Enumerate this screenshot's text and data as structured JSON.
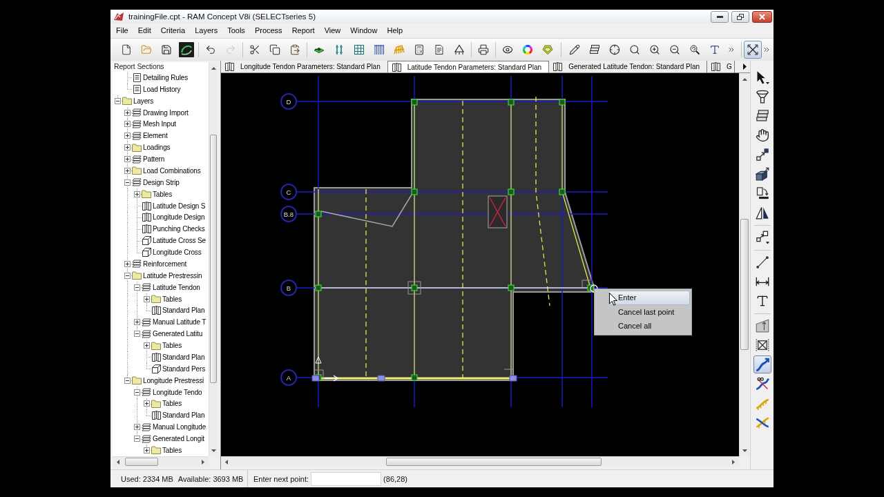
{
  "window": {
    "title": "trainingFile.cpt - RAM Concept V8i (SELECTseries 5)"
  },
  "menu": [
    "File",
    "Edit",
    "Criteria",
    "Layers",
    "Tools",
    "Process",
    "Report",
    "View",
    "Window",
    "Help"
  ],
  "toolbar": [
    {
      "disabled": false,
      "pressed": false
    },
    {
      "disabled": false,
      "pressed": false
    },
    {
      "disabled": false,
      "pressed": false
    },
    {
      "disabled": false,
      "pressed": false
    },
    {
      "disabled": false,
      "pressed": false
    },
    {
      "disabled": true,
      "pressed": false
    },
    {
      "disabled": false,
      "pressed": false
    },
    {
      "disabled": false,
      "pressed": false
    },
    {
      "disabled": false,
      "pressed": false
    },
    {
      "disabled": false,
      "pressed": false
    },
    {
      "disabled": false,
      "pressed": false
    },
    {
      "disabled": false,
      "pressed": false
    },
    {
      "disabled": false,
      "pressed": false
    },
    {
      "disabled": false,
      "pressed": false
    },
    {
      "disabled": false,
      "pressed": false
    },
    {
      "disabled": false,
      "pressed": false
    },
    {
      "disabled": false,
      "pressed": false
    },
    {
      "disabled": false,
      "pressed": false
    },
    {
      "disabled": false,
      "pressed": false
    },
    {
      "disabled": false,
      "pressed": false
    },
    {
      "disabled": false,
      "pressed": false
    },
    {
      "disabled": false,
      "pressed": false
    },
    {
      "disabled": false,
      "pressed": false
    },
    {
      "disabled": false,
      "pressed": false
    },
    {
      "disabled": false,
      "pressed": false
    },
    {
      "disabled": false,
      "pressed": false
    },
    {
      "disabled": false,
      "pressed": false
    },
    {
      "disabled": false,
      "pressed": false
    },
    {
      "disabled": false,
      "pressed": false
    },
    {
      "disabled": false,
      "pressed": false
    },
    {
      "disabled": false,
      "pressed": true
    },
    {
      "disabled": false,
      "pressed": false
    }
  ],
  "report_panel": {
    "title": "Report Sections",
    "continued_children": [
      {
        "label": "Detailing Rules",
        "kind": "report"
      },
      {
        "label": "Load History",
        "kind": "report"
      }
    ],
    "items": [
      {
        "label": "Layers",
        "kind": "folder",
        "expanded": true,
        "children": [
          {
            "label": "Drawing Import",
            "kind": "layer",
            "expanded": false
          },
          {
            "label": "Mesh Input",
            "kind": "layer",
            "expanded": false
          },
          {
            "label": "Element",
            "kind": "layer",
            "expanded": false
          },
          {
            "label": "Loadings",
            "kind": "folder",
            "expanded": false
          },
          {
            "label": "Pattern",
            "kind": "layer",
            "expanded": false
          },
          {
            "label": "Load Combinations",
            "kind": "folder",
            "expanded": false
          },
          {
            "label": "Design Strip",
            "kind": "layer",
            "expanded": true,
            "children": [
              {
                "label": "Tables",
                "kind": "folder",
                "expanded": false
              },
              {
                "label": "Latitude Design S",
                "kind": "plan"
              },
              {
                "label": "Longitude Design",
                "kind": "plan"
              },
              {
                "label": "Punching Checks",
                "kind": "plan"
              },
              {
                "label": "Latitude Cross Se",
                "kind": "perspective"
              },
              {
                "label": "Longitude Cross",
                "kind": "perspective"
              }
            ]
          },
          {
            "label": "Reinforcement",
            "kind": "layer",
            "expanded": false
          },
          {
            "label": "Latitude Prestressin",
            "kind": "folder",
            "expanded": true,
            "children": [
              {
                "label": "Latitude Tendon",
                "kind": "layer",
                "expanded": true,
                "children": [
                  {
                    "label": "Tables",
                    "kind": "folder",
                    "expanded": false
                  },
                  {
                    "label": "Standard Plan",
                    "kind": "plan"
                  }
                ]
              },
              {
                "label": "Manual Latitude T",
                "kind": "layer",
                "expanded": false
              },
              {
                "label": "Generated Latitu",
                "kind": "layer",
                "expanded": true,
                "children": [
                  {
                    "label": "Tables",
                    "kind": "folder",
                    "expanded": false
                  },
                  {
                    "label": "Standard Plan",
                    "kind": "plan"
                  },
                  {
                    "label": "Standard Pers",
                    "kind": "perspective"
                  }
                ]
              }
            ]
          },
          {
            "label": "Longitude Prestressi",
            "kind": "folder",
            "expanded": true,
            "children": [
              {
                "label": "Longitude Tendo",
                "kind": "layer",
                "expanded": true,
                "children": [
                  {
                    "label": "Tables",
                    "kind": "folder",
                    "expanded": false
                  },
                  {
                    "label": "Standard Plan",
                    "kind": "plan"
                  }
                ]
              },
              {
                "label": "Manual Longitude",
                "kind": "layer",
                "expanded": false
              },
              {
                "label": "Generated Longit",
                "kind": "layer",
                "expanded": true,
                "children": [
                  {
                    "label": "Tables",
                    "kind": "folder",
                    "expanded": false
                  }
                ]
              }
            ]
          }
        ]
      }
    ]
  },
  "tabs": [
    {
      "label": "Longitude Tendon Parameters: Standard Plan",
      "selected": false
    },
    {
      "label": "Latitude Tendon Parameters: Standard Plan",
      "selected": true
    },
    {
      "label": "Generated Latitude Tendon: Standard Plan",
      "selected": false
    },
    {
      "label": "G",
      "selected": false
    }
  ],
  "canvas": {
    "grid_lines": [
      {
        "label": "D"
      },
      {
        "label": "C"
      },
      {
        "label": "B.8"
      },
      {
        "label": "B"
      },
      {
        "label": "A"
      }
    ],
    "context_menu": [
      {
        "label": "Enter",
        "selected": true
      },
      {
        "label": "Cancel last point",
        "selected": false
      },
      {
        "label": "Cancel all",
        "selected": false
      }
    ]
  },
  "tool_palette": [
    {
      "selected": false
    },
    {
      "selected": false
    },
    {
      "selected": false
    },
    {
      "selected": false
    },
    {
      "selected": false
    },
    {
      "selected": false
    },
    {
      "selected": false
    },
    {
      "selected": false
    },
    {
      "selected": false
    },
    {
      "selected": false
    },
    {
      "selected": false
    },
    {
      "selected": false
    },
    {
      "selected": false
    },
    {
      "selected": false
    },
    {
      "selected": true
    },
    {
      "selected": false
    },
    {
      "selected": false
    },
    {
      "selected": false
    }
  ],
  "status_bar": {
    "memory_used": "Used: 2334 MB",
    "memory_available": "Available: 3693 MB",
    "prompt": "Enter next point:",
    "coordinates": "(86,28)"
  }
}
